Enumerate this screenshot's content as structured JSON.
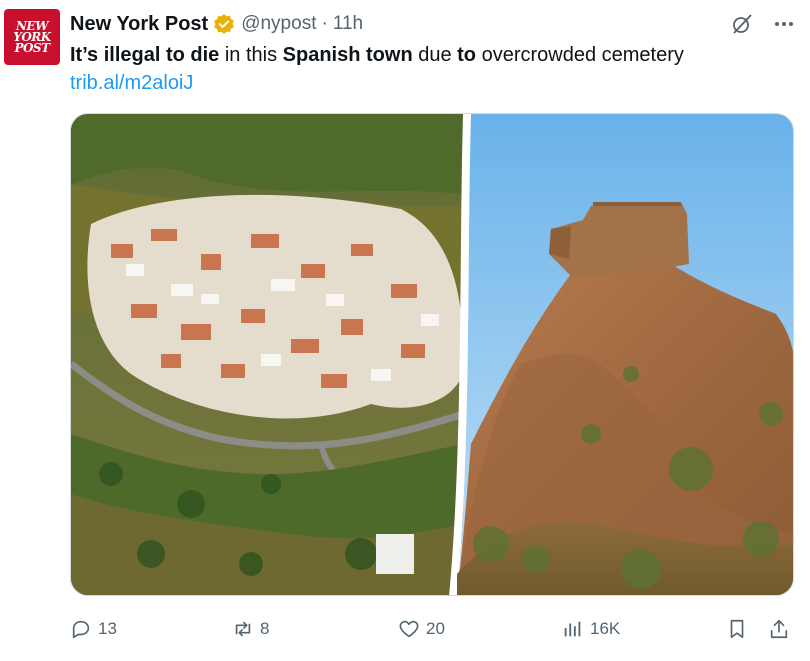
{
  "account": {
    "avatar_text": [
      "NEW",
      "YORK",
      "POST"
    ],
    "display_name": "New York Post",
    "handle": "@nypost",
    "separator": "·",
    "time": "11h",
    "verified_color": "#e8b004"
  },
  "tweet": {
    "segments": [
      {
        "text": "It’s illegal to die",
        "bold": true
      },
      {
        "text": " in this ",
        "bold": false
      },
      {
        "text": "Spanish town",
        "bold": true
      },
      {
        "text": " due ",
        "bold": false
      },
      {
        "text": "to",
        "bold": true
      },
      {
        "text": " overcrowded cemetery",
        "bold": false
      }
    ],
    "link": "trib.al/m2aloiJ"
  },
  "top_icons": [
    "grok-icon",
    "more-icon"
  ],
  "actions": {
    "replies": "13",
    "reposts": "8",
    "likes": "20",
    "views": "16K"
  },
  "colors": {
    "accent": "#1d9bf0",
    "muted": "#536471",
    "brand_red": "#c8102e"
  }
}
